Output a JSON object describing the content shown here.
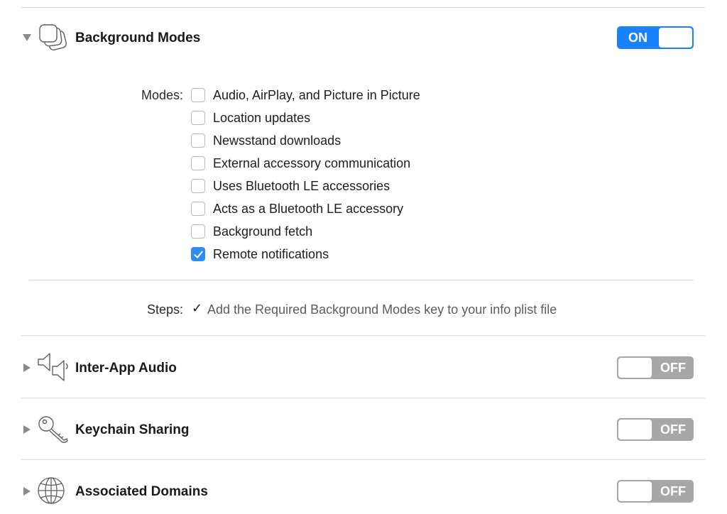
{
  "sections": {
    "background_modes": {
      "title": "Background Modes",
      "toggle": "ON",
      "icon": "stacked-windows-icon",
      "modes_label": "Modes:",
      "modes": [
        {
          "label": "Audio, AirPlay, and Picture in Picture",
          "checked": false
        },
        {
          "label": "Location updates",
          "checked": false
        },
        {
          "label": "Newsstand downloads",
          "checked": false
        },
        {
          "label": "External accessory communication",
          "checked": false
        },
        {
          "label": "Uses Bluetooth LE accessories",
          "checked": false
        },
        {
          "label": "Acts as a Bluetooth LE accessory",
          "checked": false
        },
        {
          "label": "Background fetch",
          "checked": false
        },
        {
          "label": "Remote notifications",
          "checked": true
        }
      ],
      "steps_label": "Steps:",
      "steps_check": "✓",
      "steps_text": "Add the Required Background Modes key to your info plist file"
    },
    "inter_app_audio": {
      "title": "Inter-App Audio",
      "toggle": "OFF",
      "icon": "speakers-icon"
    },
    "keychain_sharing": {
      "title": "Keychain Sharing",
      "toggle": "OFF",
      "icon": "key-icon"
    },
    "associated_domains": {
      "title": "Associated Domains",
      "toggle": "OFF",
      "icon": "globe-icon"
    }
  },
  "colors": {
    "toggle_on": "#1a82fb",
    "toggle_off": "#a7a7a7",
    "checkbox_checked": "#2d8cf7"
  }
}
